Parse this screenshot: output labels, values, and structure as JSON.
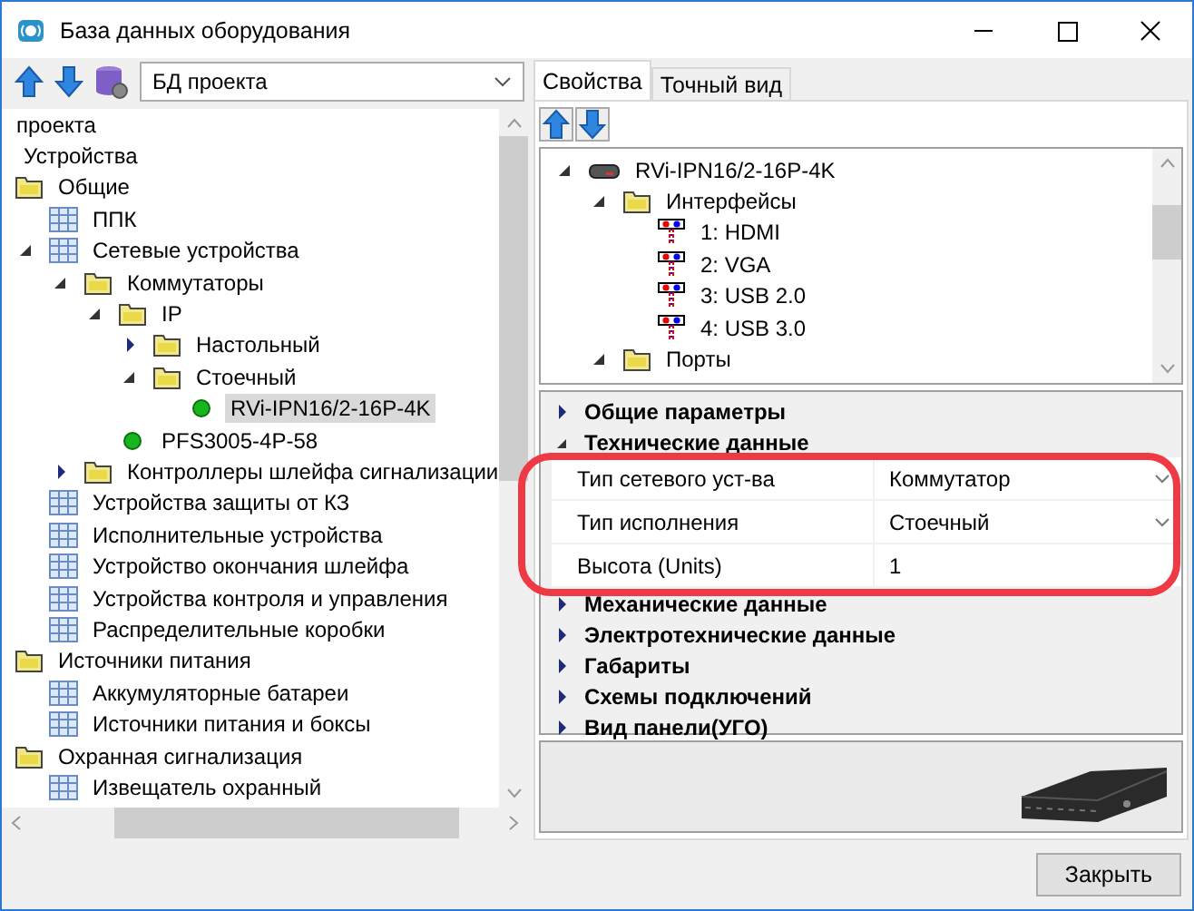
{
  "window": {
    "title": "База данных оборудования"
  },
  "left_panel": {
    "database_select": {
      "value": "БД проекта"
    },
    "tree": [
      {
        "label": "проекта",
        "children": [
          {
            "label": "Устройства",
            "children": [
              {
                "label": "Общие",
                "kind": "folder",
                "children": [
                  {
                    "label": "ППК",
                    "kind": "table"
                  },
                  {
                    "label": "Сетевые устройства",
                    "kind": "table",
                    "expanded": true,
                    "children": [
                      {
                        "label": "Коммутаторы",
                        "kind": "folder",
                        "expanded": true,
                        "children": [
                          {
                            "label": "IP",
                            "kind": "folder",
                            "expanded": true,
                            "children": [
                              {
                                "label": "Настольный",
                                "kind": "folder",
                                "expanded": false
                              },
                              {
                                "label": "Стоечный",
                                "kind": "folder",
                                "expanded": true,
                                "children": [
                                  {
                                    "label": "RVi-IPN16/2-16P-4K",
                                    "kind": "device",
                                    "selected": true
                                  }
                                ]
                              }
                            ]
                          },
                          {
                            "label": "PFS3005-4P-58",
                            "kind": "device",
                            "selected": false
                          }
                        ]
                      },
                      {
                        "label": "Контроллеры шлейфа сигнализации",
                        "kind": "folder",
                        "expanded": false
                      }
                    ]
                  },
                  {
                    "label": "Устройства защиты от КЗ",
                    "kind": "table"
                  },
                  {
                    "label": "Исполнительные устройства",
                    "kind": "table"
                  },
                  {
                    "label": "Устройство окончания шлейфа",
                    "kind": "table"
                  },
                  {
                    "label": "Устройства контроля и управления",
                    "kind": "table"
                  },
                  {
                    "label": "Распределительные коробки",
                    "kind": "table"
                  }
                ]
              },
              {
                "label": "Источники питания",
                "kind": "folder",
                "children": [
                  {
                    "label": "Аккумуляторные батареи",
                    "kind": "table"
                  },
                  {
                    "label": "Источники питания и боксы",
                    "kind": "table"
                  }
                ]
              },
              {
                "label": "Охранная сигнализация",
                "kind": "folder",
                "children": [
                  {
                    "label": "Извещатель охранный",
                    "kind": "table"
                  }
                ]
              }
            ]
          }
        ]
      }
    ]
  },
  "right_panel": {
    "tabs": [
      {
        "label": "Свойства",
        "selected": true
      },
      {
        "label": "Точный вид",
        "selected": false
      }
    ],
    "structure_tree": [
      {
        "label": "RVi-IPN16/2-16P-4K",
        "kind": "device",
        "expanded": true,
        "children": [
          {
            "label": "Интерфейсы",
            "kind": "folder",
            "expanded": true,
            "children": [
              {
                "label": "1: HDMI",
                "kind": "connector"
              },
              {
                "label": "2: VGA",
                "kind": "connector"
              },
              {
                "label": "3: USB 2.0",
                "kind": "connector"
              },
              {
                "label": "4: USB 3.0",
                "kind": "connector"
              }
            ]
          },
          {
            "label": "Порты",
            "kind": "folder",
            "expanded": true
          }
        ]
      }
    ],
    "property_groups": [
      {
        "title": "Общие параметры",
        "expanded": false
      },
      {
        "title": "Технические данные",
        "expanded": true,
        "properties": [
          {
            "name": "Тип сетевого уст-ва",
            "value": "Коммутатор",
            "kind": "dropdown"
          },
          {
            "name": "Тип исполнения",
            "value": "Стоечный",
            "kind": "dropdown"
          },
          {
            "name": "Высота (Units)",
            "value": "1",
            "kind": "text"
          }
        ]
      },
      {
        "title": "Механические данные",
        "expanded": false
      },
      {
        "title": "Электротехнические данные",
        "expanded": false
      },
      {
        "title": "Габариты",
        "expanded": false
      },
      {
        "title": "Схемы подключений",
        "expanded": false
      },
      {
        "title": "Вид панели(УГО)",
        "expanded": false
      }
    ]
  },
  "buttons": [
    {
      "label": "Закрыть"
    }
  ]
}
